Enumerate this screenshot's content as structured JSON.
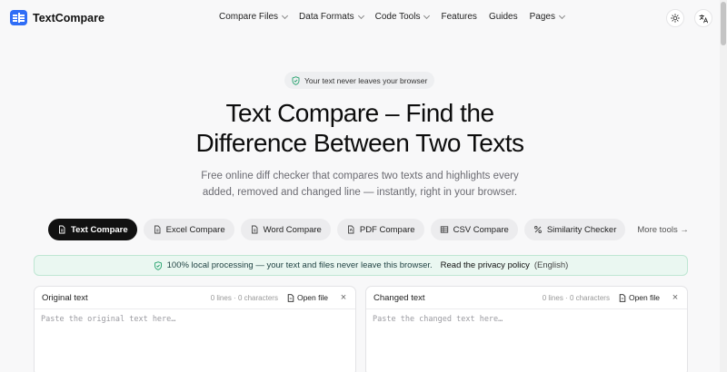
{
  "header": {
    "brand": "TextCompare",
    "nav": [
      {
        "label": "Compare Files",
        "dropdown": true
      },
      {
        "label": "Data Formats",
        "dropdown": true
      },
      {
        "label": "Code Tools",
        "dropdown": true
      },
      {
        "label": "Features",
        "dropdown": false
      },
      {
        "label": "Guides",
        "dropdown": false
      },
      {
        "label": "Pages",
        "dropdown": true
      }
    ],
    "theme_icon": "sun-icon",
    "language_icon": "translate-icon"
  },
  "hero": {
    "badge": "Your text never leaves your browser",
    "title_line1": "Text Compare – Find the",
    "title_line2": "Difference Between Two Texts",
    "subtitle_line1": "Free online diff checker that compares two texts and highlights every",
    "subtitle_line2": "added, removed and changed line — instantly, right in your browser."
  },
  "tools": [
    {
      "label": "Text Compare",
      "icon": "document-icon",
      "active": true
    },
    {
      "label": "Excel Compare",
      "icon": "document-icon",
      "active": false
    },
    {
      "label": "Word Compare",
      "icon": "document-icon",
      "active": false
    },
    {
      "label": "PDF Compare",
      "icon": "pdf-icon",
      "active": false
    },
    {
      "label": "CSV Compare",
      "icon": "table-icon",
      "active": false
    },
    {
      "label": "Similarity Checker",
      "icon": "percent-icon",
      "active": false
    }
  ],
  "more_tools": "More tools →",
  "notice": {
    "text": "100% local processing — your text and files never leave this browser.",
    "link": "Read the privacy policy",
    "lang": "(English)"
  },
  "editors": {
    "original": {
      "title": "Original text",
      "meta": "0 lines · 0 characters",
      "open": "Open file",
      "placeholder": "Paste the original text here…"
    },
    "changed": {
      "title": "Changed text",
      "meta": "0 lines · 0 characters",
      "open": "Open file",
      "placeholder": "Paste the changed text here…"
    }
  },
  "colors": {
    "brand": "#2f6df6",
    "active_tab": "#111111",
    "notice_bg": "#eaf7f1",
    "notice_border": "#bfe6d3"
  }
}
